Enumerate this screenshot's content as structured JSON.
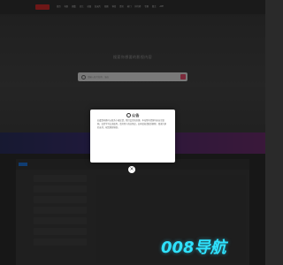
{
  "topbar": {
    "nav": [
      "首页",
      "电影",
      "剧集",
      "综艺",
      "动漫",
      "纪录片",
      "短剧",
      "体育",
      "资讯",
      "热门",
      "排行榜",
      "专题",
      "留言",
      "APP"
    ]
  },
  "hero": {
    "title": "搜索你想要的影视内容",
    "search_placeholder": "请输入影片名称、演员"
  },
  "modal": {
    "title": "公告",
    "body": "如遇到问题可以联系小编反馈，我们会尽快处理。本站所有资源均来自互联网，仅供学习交流使用。请勿用于商业用途，如有侵权请联系删除。感谢大家的支持，祝您观影愉快。"
  },
  "close_label": "×",
  "brand": "008导航",
  "colors": {
    "brand": "#2fe3ff",
    "logo": "#c82a2a",
    "accent": "#e24b6a"
  }
}
